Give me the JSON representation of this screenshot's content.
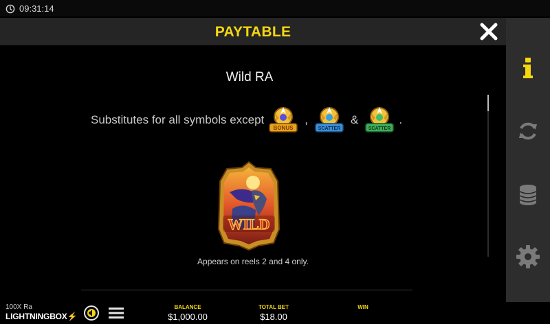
{
  "status": {
    "time": "09:31:14"
  },
  "header": {
    "title": "PAYTABLE"
  },
  "symbol": {
    "name": "Wild RA",
    "substitutes_text": "Substitutes for all symbols except",
    "separator_1": ",",
    "separator_2": "&",
    "end_punct": ".",
    "except_symbols": [
      {
        "label": "BONUS",
        "icon": "bonus-symbol"
      },
      {
        "label": "SCATTER",
        "icon": "scatter-symbol"
      },
      {
        "label": "SCATTER",
        "icon": "scatter-gold-symbol"
      }
    ],
    "big_label": "WILD",
    "reels_text": "Appears on reels 2 and 4 only."
  },
  "bottom": {
    "game_name": "100X Ra",
    "brand_word": "LIGHTNING",
    "brand_box": "BOX",
    "balance_label": "BALANCE",
    "balance_value": "$1,000.00",
    "bet_label": "TOTAL BET",
    "bet_value": "$18.00",
    "win_label": "WIN",
    "win_value": ""
  },
  "colors": {
    "accent": "#f4d70f",
    "panel_bg": "#000000",
    "header_bg": "#252525",
    "sidebar_bg": "#2d2d2d"
  },
  "icons": {
    "sidebar": [
      "info-icon",
      "refresh-icon",
      "coins-icon",
      "gear-icon"
    ],
    "close": "close-icon",
    "menu": "hamburger-icon",
    "sound": "speaker-icon"
  }
}
